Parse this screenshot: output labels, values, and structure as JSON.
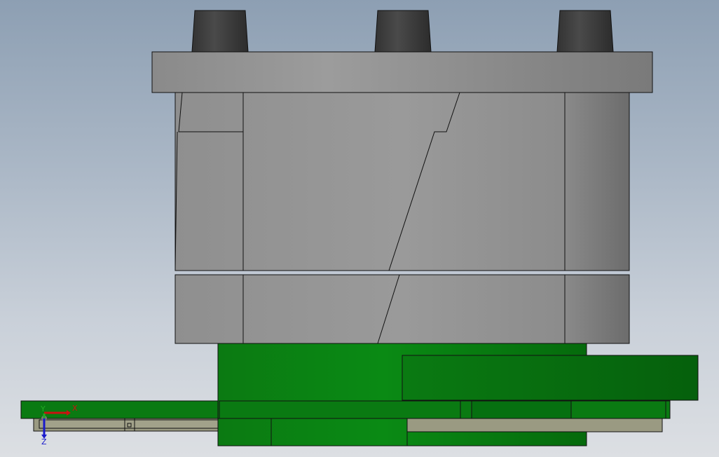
{
  "viewport": {
    "background_top": "#8d9fb3",
    "background_bottom": "#dcdfe3"
  },
  "model": {
    "colors": {
      "grey_light": "#999999",
      "grey_mid": "#8c8c8c",
      "grey_dark": "#727272",
      "bolt": "#3c3c3c",
      "green": "#0a7a12",
      "green_dark": "#055e0c",
      "tan": "#9a9a82",
      "outline": "#111111"
    }
  },
  "triad": {
    "x_label": "X",
    "y_label": "Y",
    "z_label": "Z",
    "x_color": "#cc1111",
    "y_color": "#22aa22",
    "z_color": "#1a1acc"
  }
}
